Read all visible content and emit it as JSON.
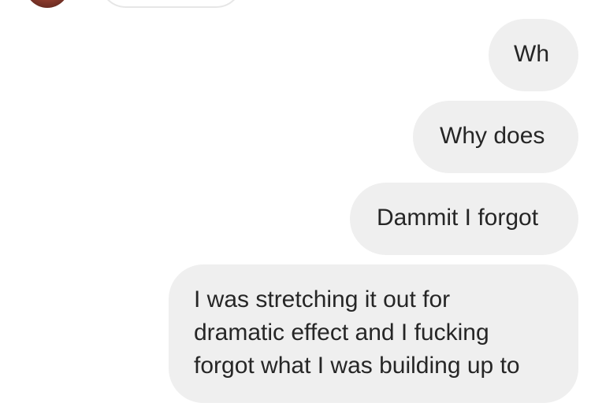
{
  "conversation": {
    "messages": [
      {
        "sender": "me",
        "text": "Wh"
      },
      {
        "sender": "me",
        "text": "Why does"
      },
      {
        "sender": "me",
        "text": "Dammit I forgot"
      },
      {
        "sender": "me",
        "lines": [
          "I was stretching it out for",
          "dramatic effect and I fucking",
          "forgot what I was building up to"
        ]
      }
    ]
  },
  "colors": {
    "outgoing_bubble": "#efefef",
    "text": "#262626",
    "background": "#ffffff"
  }
}
